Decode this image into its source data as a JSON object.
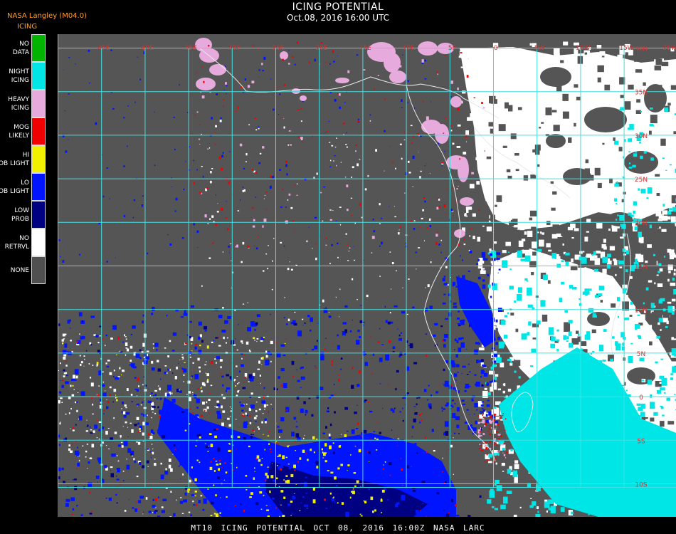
{
  "header": {
    "credit": "NASA Langley (M04.0)",
    "product": "ICING",
    "title": "ICING POTENTIAL",
    "subtitle": "Oct.08, 2016 16:00 UTC"
  },
  "legend": [
    {
      "label": "NO DATA",
      "color": "#00b400"
    },
    {
      "label": "NIGHT ICING",
      "color": "#00e6e6"
    },
    {
      "label": "HEAVY ICING",
      "color": "#e6aadc"
    },
    {
      "label": "MOG LIKELY",
      "color": "#f00000"
    },
    {
      "label": "HI PROB LIGHT",
      "color": "#f0f000"
    },
    {
      "label": "LO PROB LIGHT",
      "color": "#0014ff"
    },
    {
      "label": "LOW PROB",
      "color": "#000082"
    },
    {
      "label": "NO RETRVL",
      "color": "#ffffff"
    },
    {
      "label": "NONE",
      "color": "#505050"
    }
  ],
  "map": {
    "background_color": "#555555",
    "grid_color": "#40e0e0",
    "grid_label_color": "#d23232",
    "longitude_labels": [
      "45E",
      "40E",
      "35E",
      "30E",
      "25E",
      "20E",
      "15E",
      "10E",
      "5E",
      "0",
      "5W",
      "10W",
      "15W",
      "20W"
    ],
    "latitude_labels": [
      "40N",
      "35N",
      "30N",
      "25N",
      "20N",
      "15N",
      "10N",
      "5N",
      "0",
      "5S",
      "10S",
      "15S",
      "20S",
      "25S",
      "30S",
      "35S",
      "40S"
    ]
  },
  "footer": {
    "text": "MT10  ICING POTENTIAL   OCT 08, 2016 16:00Z   NASA LARC"
  }
}
